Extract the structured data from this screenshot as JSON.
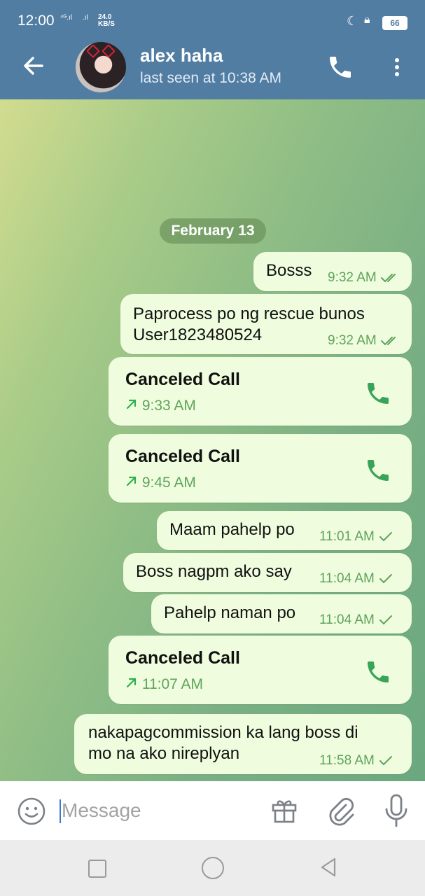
{
  "status_bar": {
    "time": "12:00",
    "network1": "⁴ᴳ.ıl",
    "network2": ".ıl",
    "speed_value": "24.0",
    "speed_unit": "KB/S",
    "battery": "66"
  },
  "header": {
    "contact_name": "alex haha",
    "last_seen": "last seen at 10:38 AM"
  },
  "date_separator": "February 13",
  "messages": [
    {
      "type": "text",
      "text": "Bosss",
      "time": "9:32 AM",
      "status": "read"
    },
    {
      "type": "text",
      "text_line1": "Paprocess po ng rescue bunos",
      "text_line2": "User1823480524",
      "time": "9:32 AM",
      "status": "read"
    },
    {
      "type": "call",
      "title": "Canceled Call",
      "time": "9:33 AM"
    },
    {
      "type": "call",
      "title": "Canceled Call",
      "time": "9:45 AM"
    },
    {
      "type": "text",
      "text": "Maam pahelp po",
      "time": "11:01 AM",
      "status": "sent"
    },
    {
      "type": "text",
      "text": "Boss nagpm ako say",
      "time": "11:04 AM",
      "status": "sent"
    },
    {
      "type": "text",
      "text": "Pahelp naman po",
      "time": "11:04 AM",
      "status": "sent"
    },
    {
      "type": "call",
      "title": "Canceled Call",
      "time": "11:07 AM"
    },
    {
      "type": "text",
      "text_line1": "nakapagcommission ka lang boss di",
      "text_line2": "mo na ako nireplyan",
      "time": "11:58 AM",
      "status": "sent"
    }
  ],
  "composer": {
    "placeholder": "Message"
  },
  "colors": {
    "header": "#527da3",
    "bubble_out": "#effdde",
    "accent_green": "#5fa35b"
  }
}
